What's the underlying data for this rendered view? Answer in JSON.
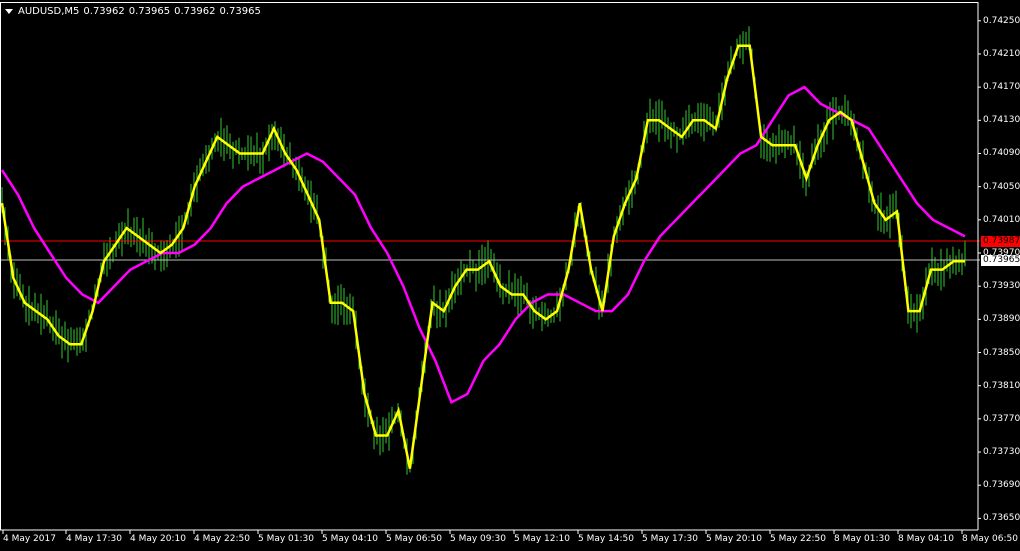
{
  "header": {
    "symbol": "AUDUSD,M5",
    "open": "0.73962",
    "high": "0.73965",
    "low": "0.73962",
    "close": "0.73965"
  },
  "y_axis_labels": [
    "0.74250",
    "0.74210",
    "0.74170",
    "0.74130",
    "0.74090",
    "0.74050",
    "0.74010",
    "0.73970",
    "0.73930",
    "0.73890",
    "0.73850",
    "0.73810",
    "0.73770",
    "0.73730",
    "0.73690",
    "0.73650"
  ],
  "x_axis_labels": [
    "4 May 2017",
    "4 May 17:30",
    "4 May 20:10",
    "4 May 22:50",
    "5 May 01:30",
    "5 May 04:10",
    "5 May 06:50",
    "5 May 09:30",
    "5 May 12:10",
    "5 May 14:50",
    "5 May 17:30",
    "5 May 20:10",
    "5 May 22:50",
    "8 May 01:30",
    "8 May 04:10",
    "8 May 06:50"
  ],
  "price_markers": {
    "bid": "0.73987",
    "last": "0.73965"
  },
  "colors": {
    "background": "#000000",
    "bars": "#35c735",
    "fast_ma": "#ffff00",
    "slow_ma": "#ff00ff",
    "bid_line": "#ff0000",
    "last_line": "#c0c0c0",
    "axis": "#ffffff"
  },
  "chart_data": {
    "type": "line",
    "ylim": [
      0.73636,
      0.74263
    ],
    "series": [
      {
        "values": [
          0.7403,
          0.7394,
          0.7391,
          0.739,
          0.7389,
          0.7387,
          0.7386,
          0.7386,
          0.739,
          0.7396,
          0.7398,
          0.74,
          0.7399,
          0.7398,
          0.7397,
          0.7398,
          0.74,
          0.7405,
          0.7408,
          0.7411,
          0.741,
          0.7409,
          0.7409,
          0.7409,
          0.7412,
          0.7409,
          0.7407,
          0.7404,
          0.7401,
          0.7391,
          0.7391,
          0.739,
          0.738,
          0.7375,
          0.7375,
          0.7378,
          0.7371,
          0.7381,
          0.7391,
          0.739,
          0.7393,
          0.7395,
          0.7395,
          0.7396,
          0.7393,
          0.7392,
          0.7392,
          0.739,
          0.7389,
          0.739,
          0.7395,
          0.7403,
          0.7395,
          0.739,
          0.7399,
          0.7403,
          0.7406,
          0.7413,
          0.7413,
          0.7412,
          0.7411,
          0.7413,
          0.7413,
          0.7412,
          0.7418,
          0.7422,
          0.7422,
          0.7411,
          0.741,
          0.741,
          0.741,
          0.7406,
          0.741,
          0.7413,
          0.7414,
          0.7413,
          0.7408,
          0.7403,
          0.7401,
          0.7402,
          0.739,
          0.739,
          0.7395,
          0.7395,
          0.7396,
          0.7396
        ]
      },
      {
        "values": [
          0.7407,
          0.7404,
          0.74,
          0.7397,
          0.7394,
          0.7392,
          0.7391,
          0.7393,
          0.7395,
          0.7396,
          0.7397,
          0.7397,
          0.7398,
          0.74,
          0.7403,
          0.7405,
          0.7406,
          0.7407,
          0.7408,
          0.7409,
          0.7408,
          0.7406,
          0.7404,
          0.74,
          0.7397,
          0.7393,
          0.7388,
          0.7384,
          0.7379,
          0.738,
          0.7384,
          0.7386,
          0.7389,
          0.7391,
          0.7392,
          0.7392,
          0.7391,
          0.739,
          0.739,
          0.7392,
          0.7396,
          0.7399,
          0.7401,
          0.7403,
          0.7405,
          0.7407,
          0.7409,
          0.741,
          0.7413,
          0.7416,
          0.7417,
          0.7415,
          0.7414,
          0.7413,
          0.7412,
          0.7409,
          0.7406,
          0.7403,
          0.7401,
          0.74,
          0.7399
        ]
      }
    ]
  }
}
